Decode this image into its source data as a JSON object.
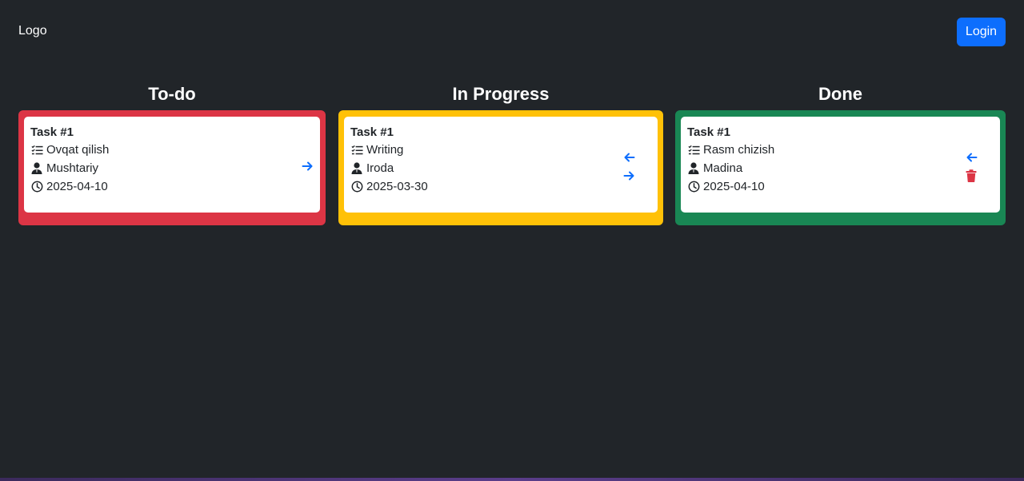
{
  "navbar": {
    "logo": "Logo",
    "login_label": "Login"
  },
  "colors": {
    "background": "#212529",
    "todo": "#dc3545",
    "in_progress": "#ffc107",
    "done": "#198754",
    "accent": "#0d6efd",
    "danger": "#dc3545"
  },
  "columns": [
    {
      "title": "To-do",
      "tasks": [
        {
          "title": "Task #1",
          "name": "Ovqat qilish",
          "assignee": "Mushtariy",
          "date": "2025-04-10",
          "actions": [
            "arrow-right-icon"
          ]
        }
      ]
    },
    {
      "title": "In Progress",
      "tasks": [
        {
          "title": "Task #1",
          "name": "Writing",
          "assignee": "Iroda",
          "date": "2025-03-30",
          "actions": [
            "arrow-left-icon",
            "arrow-right-icon"
          ]
        }
      ]
    },
    {
      "title": "Done",
      "tasks": [
        {
          "title": "Task #1",
          "name": "Rasm chizish",
          "assignee": "Madina",
          "date": "2025-04-10",
          "actions": [
            "arrow-left-icon",
            "trash-icon"
          ]
        }
      ]
    }
  ]
}
